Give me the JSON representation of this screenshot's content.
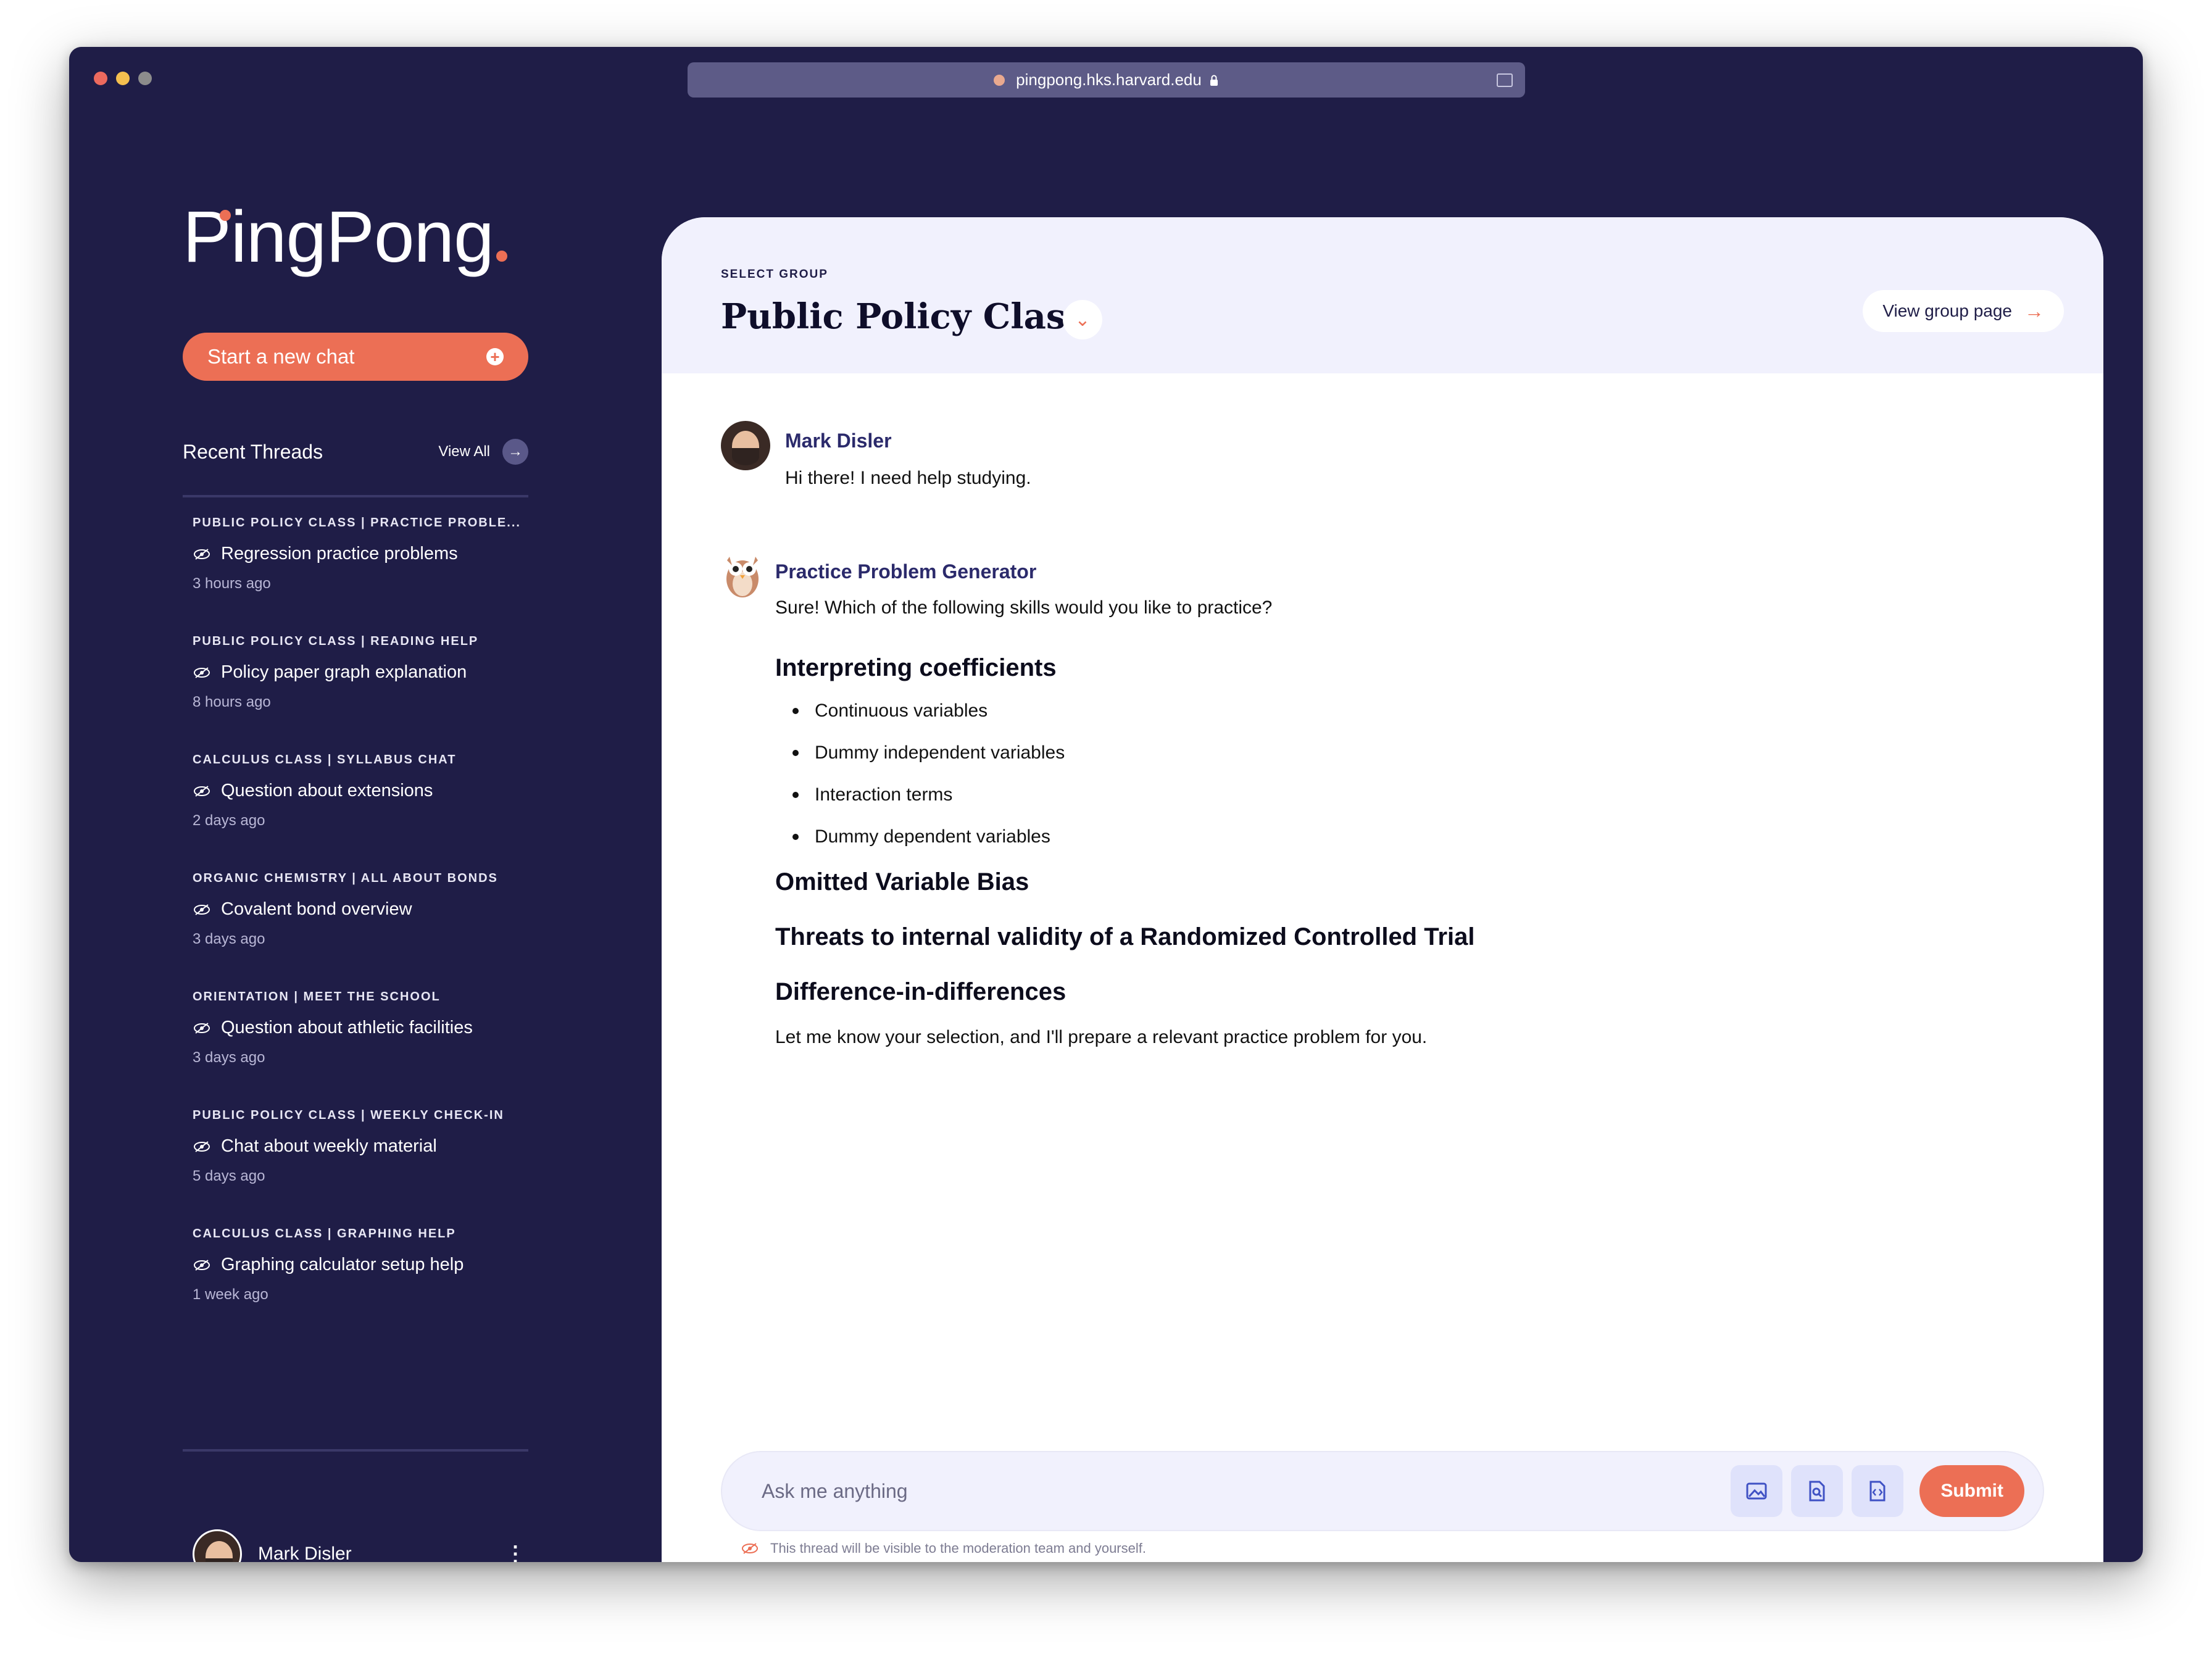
{
  "browser": {
    "url": "pingpong.hks.harvard.edu"
  },
  "sidebar": {
    "logo": "PingPong",
    "new_chat_label": "Start a new chat",
    "recent_title": "Recent Threads",
    "view_all_label": "View All",
    "threads": [
      {
        "context": "PUBLIC POLICY CLASS | PRACTICE PROBLE...",
        "name": "Regression practice problems",
        "time": "3 hours ago"
      },
      {
        "context": "PUBLIC POLICY CLASS | READING HELP",
        "name": "Policy paper graph explanation",
        "time": "8 hours ago"
      },
      {
        "context": "CALCULUS CLASS | SYLLABUS CHAT",
        "name": "Question about extensions",
        "time": "2 days ago"
      },
      {
        "context": "ORGANIC CHEMISTRY | ALL ABOUT BONDS",
        "name": "Covalent bond overview",
        "time": "3 days ago"
      },
      {
        "context": "ORIENTATION | MEET THE SCHOOL",
        "name": "Question about athletic facilities",
        "time": "3 days ago"
      },
      {
        "context": "PUBLIC POLICY CLASS | WEEKLY CHECK-IN",
        "name": "Chat about weekly material",
        "time": "5 days ago"
      },
      {
        "context": "CALCULUS CLASS | GRAPHING HELP",
        "name": "Graphing calculator setup help",
        "time": "1 week ago"
      }
    ],
    "user_name": "Mark Disler"
  },
  "header": {
    "select_label": "SELECT GROUP",
    "group_title": "Public Policy Class",
    "view_group_label": "View group page"
  },
  "conversation": {
    "user_msg": {
      "sender": "Mark Disler",
      "text": "Hi there! I need help studying."
    },
    "bot_msg": {
      "sender": "Practice Problem Generator",
      "intro": "Sure! Which of the following skills would you like to practice?",
      "heading1": "Interpreting coefficients",
      "items": [
        "Continuous variables",
        "Dummy independent variables",
        "Interaction terms",
        "Dummy dependent variables"
      ],
      "heading2": "Omitted Variable Bias",
      "heading3": "Threats to internal validity of a Randomized Controlled Trial",
      "heading4": "Difference-in-differences",
      "outro": "Let me know your selection, and I'll prepare a relevant practice problem for you."
    }
  },
  "composer": {
    "placeholder": "Ask me anything",
    "submit_label": "Submit",
    "note": "This thread will be visible to the moderation team and yourself."
  },
  "colors": {
    "sidebar_bg": "#1f1d47",
    "accent": "#ec6f55",
    "header_bg": "#f1f1fd"
  },
  "icons": [
    "image-upload-icon",
    "document-search-icon",
    "code-file-icon",
    "eye-slash-icon",
    "chevron-down-icon",
    "arrow-right-icon",
    "plus-circle-icon",
    "kebab-icon"
  ]
}
